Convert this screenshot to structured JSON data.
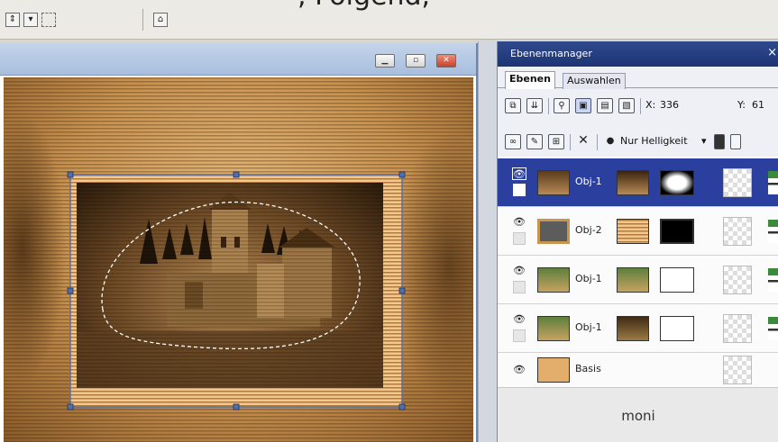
{
  "top_caption": ", Folgend,",
  "toolbar": {
    "icons": [
      "align-distribute-icon",
      "align-menu-icon",
      "select-box-icon",
      "home-object-icon"
    ]
  },
  "document_window": {
    "buttons": [
      "minimize",
      "restore",
      "close"
    ]
  },
  "layer_panel": {
    "title": "Ebenenmanager",
    "close_label": "×",
    "tabs": [
      {
        "label": "Ebenen",
        "active": true
      },
      {
        "label": "Auswahlen",
        "active": false
      }
    ],
    "coords": {
      "x_label": "X:",
      "x_value": "336",
      "y_label": "Y:",
      "y_value": "61"
    },
    "filter_label": "Nur Helligkeit",
    "layers": [
      {
        "name": "Obj-1",
        "selected": true,
        "thumb": "photo",
        "mask": "white-blob"
      },
      {
        "name": "Obj-2",
        "selected": false,
        "thumb": "gray",
        "mask": "black"
      },
      {
        "name": "Obj-1",
        "selected": false,
        "thumb": "landscape",
        "mask": "white"
      },
      {
        "name": "Obj-1",
        "selected": false,
        "thumb": "landscape",
        "mask": "white"
      },
      {
        "name": "Basis",
        "selected": false,
        "thumb": "tan",
        "mask": ""
      }
    ],
    "footer": "moni"
  }
}
